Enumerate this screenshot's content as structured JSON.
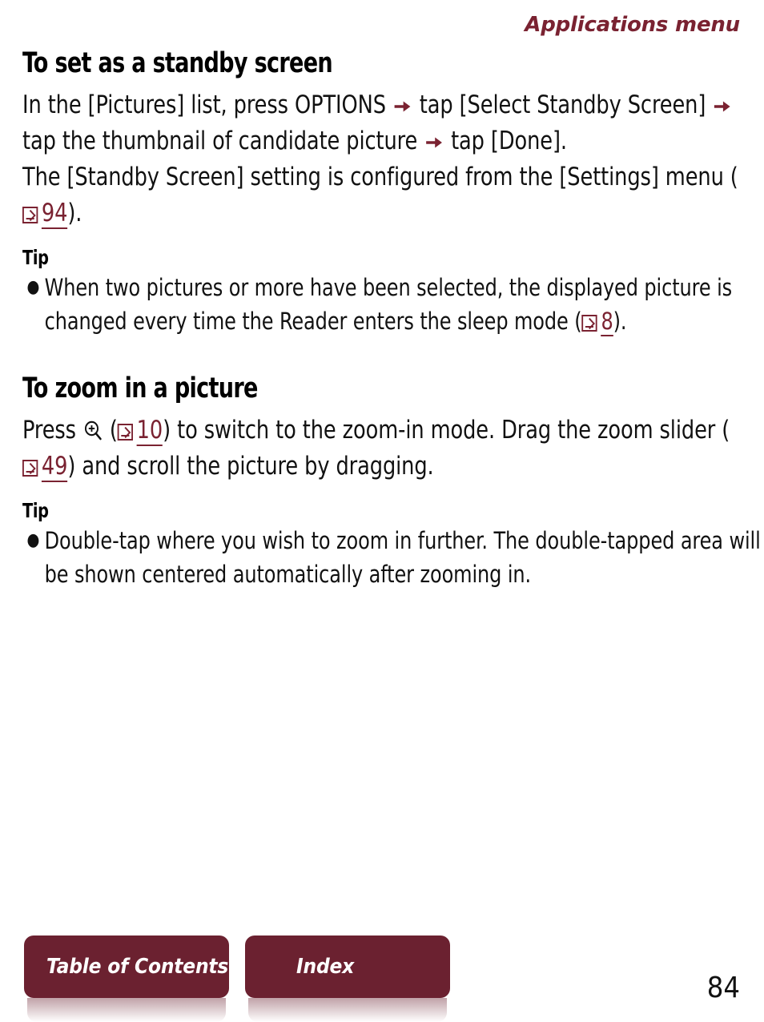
{
  "header": {
    "running_title": "Applications menu"
  },
  "accent_colors": {
    "maroon": "#7a2231",
    "button_bg": "#6b2130",
    "text": "#111111"
  },
  "sections": [
    {
      "title": "To set as a standby screen",
      "paragraph": {
        "part1": "In the [Pictures] list, press OPTIONS ",
        "part2": " tap [Select Standby Screen] ",
        "part3": " tap the thumbnail of candidate picture ",
        "part4": " tap [Done].",
        "line2_pre": "The [Standby Screen] setting is configured from the [Settings] menu (",
        "line2_pageref": "94",
        "line2_post": ")."
      },
      "tip_title": "Tip",
      "tips": [
        {
          "pre": "When two pictures or more have been selected, the displayed picture is changed every time the Reader enters the sleep mode (",
          "pageref": "8",
          "post": ")."
        }
      ]
    },
    {
      "title": "To zoom in a picture",
      "paragraph": {
        "pre": "Press ",
        "mid1": " (",
        "pageref1": "10",
        "mid2": ") to switch to the zoom-in mode. Drag the zoom slider (",
        "pageref2": "49",
        "post": ") and scroll the picture by dragging."
      },
      "tip_title": "Tip",
      "tips": [
        {
          "text": "Double-tap where you wish to zoom in further. The double-tapped area will be shown centered automatically after zooming in."
        }
      ]
    }
  ],
  "footer": {
    "toc_label": "Table of Contents",
    "index_label": "Index",
    "page_number": "84"
  },
  "icons": {
    "arrow": "right-arrow-icon",
    "jump": "page-jump-icon",
    "magnifier": "zoom-in-icon"
  }
}
